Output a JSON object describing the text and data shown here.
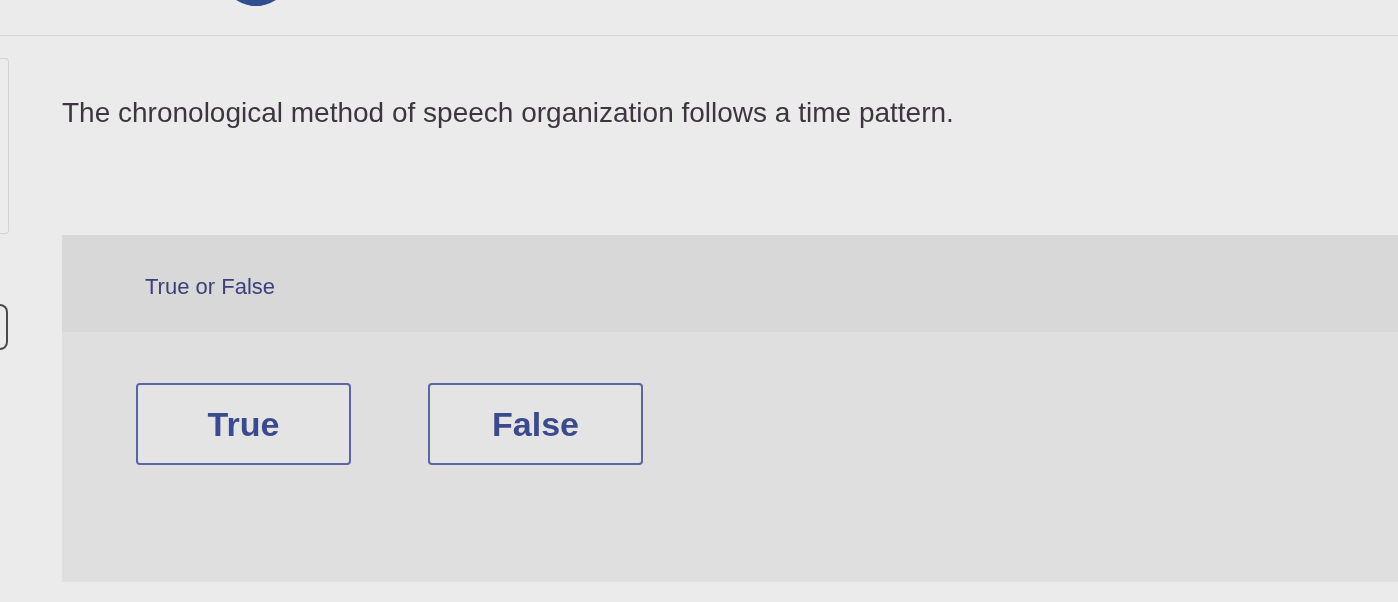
{
  "question": {
    "text": "The chronological method of speech organization follows a time pattern."
  },
  "answer_panel": {
    "prompt": "True or False",
    "choices": [
      {
        "label": "True",
        "selected": false
      },
      {
        "label": "False",
        "selected": false
      }
    ]
  }
}
